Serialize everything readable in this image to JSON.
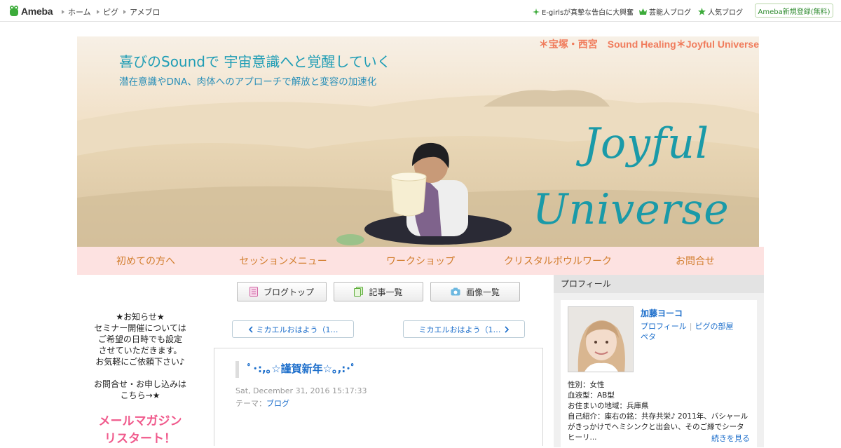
{
  "topbar": {
    "logo_text": "Ameba",
    "nav": [
      "ホーム",
      "ピグ",
      "アメブロ"
    ],
    "right_links": [
      {
        "label": "E-girlsが真摯な告白に大興奮",
        "icon": "sparkle-icon"
      },
      {
        "label": "芸能人ブログ",
        "icon": "crown-icon"
      },
      {
        "label": "人気ブログ",
        "icon": "star-icon"
      }
    ],
    "signup_label": "Ameba新規登録(無料)"
  },
  "banner": {
    "tagline": "＊宝塚・西宮　Sound Healing＊Joyful Universe",
    "headline": "喜びのSoundで 宇宙意識へと覚醒していく",
    "subline": "潜在意識やDNA、肉体へのアプローチで解放と変容の加速化",
    "script_line1": "Joyful",
    "script_line2": "Universe"
  },
  "nav": {
    "items": [
      "初めての方へ",
      "セッションメニュー",
      "ワークショップ",
      "クリスタルボウルワーク",
      "お問合せ"
    ]
  },
  "blog_buttons": {
    "top": "ブログトップ",
    "list": "記事一覧",
    "images": "画像一覧"
  },
  "sidebar_notice": {
    "lines": [
      "★お知らせ★",
      "セミナー開催については",
      "ご希望の日時でも設定",
      "させていただきます。",
      "お気軽にご依頼下さい♪",
      "",
      "お問合せ・お申し込みは",
      "こちら→★"
    ],
    "mailmag_line1": "メールマガジン",
    "mailmag_line2": "リスタート！"
  },
  "pager": {
    "prev": "ミカエルおはよう（1…",
    "next": "ミカエルおはよう（1…"
  },
  "article": {
    "title": "ﾟ･:,｡☆謹賀新年☆｡,:･ﾟ",
    "date": "Sat, December 31, 2016 15:17:33",
    "theme_label": "テーマ：",
    "theme_value": "ブログ"
  },
  "profile": {
    "header": "プロフィール",
    "name": "加藤ヨーコ",
    "link_profile": "プロフィール",
    "link_pig": "ピグの部屋",
    "link_peta": "ペタ",
    "info": [
      "性別：女性",
      "血液型：AB型",
      "お住まいの地域：兵庫県",
      "自己紹介：座右の銘：共存共栄♪ 2011年、バシャールがきっかけでヘミシンクと出会い、そのご縁でシータヒーリ..."
    ],
    "more": "続きを見る"
  },
  "colors": {
    "nav_bg": "#fde2e1",
    "nav_text": "#d27e2e",
    "link": "#1c6ecb",
    "banner_script": "#1a9aa8",
    "banner_tagline": "#f07c5c",
    "mailmag": "#f05a8c"
  }
}
